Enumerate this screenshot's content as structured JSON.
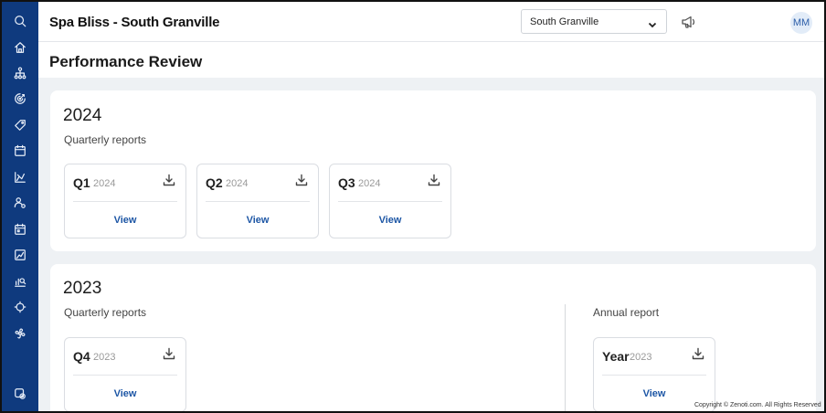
{
  "header": {
    "app_title": "Spa Bliss - South Granville",
    "center_select": "South Granville",
    "avatar_initials": "MM"
  },
  "page_title": "Performance Review",
  "sidebar": {
    "icons": [
      "search-icon",
      "home-icon",
      "org-chart-icon",
      "target-icon",
      "tag-icon",
      "calendar-icon",
      "chart-icon",
      "user-settings-icon",
      "schedule-icon",
      "image-chart-icon",
      "analytics-icon",
      "refresh-icon",
      "fan-icon",
      "settings-icon"
    ]
  },
  "years": [
    {
      "year": "2024",
      "quarterly_label": "Quarterly reports",
      "reports": [
        {
          "quarter": "Q1",
          "year": "2024",
          "view": "View"
        },
        {
          "quarter": "Q2",
          "year": "2024",
          "view": "View"
        },
        {
          "quarter": "Q3",
          "year": "2024",
          "view": "View"
        }
      ]
    },
    {
      "year": "2023",
      "quarterly_label": "Quarterly reports",
      "annual_label": "Annual report",
      "reports": [
        {
          "quarter": "Q4",
          "year": "2023",
          "view": "View"
        }
      ],
      "annual": {
        "label": "Year",
        "year": "2023",
        "view": "View"
      }
    }
  ],
  "copyright": "Copyright © Zenoti.com. All Rights Reserved"
}
